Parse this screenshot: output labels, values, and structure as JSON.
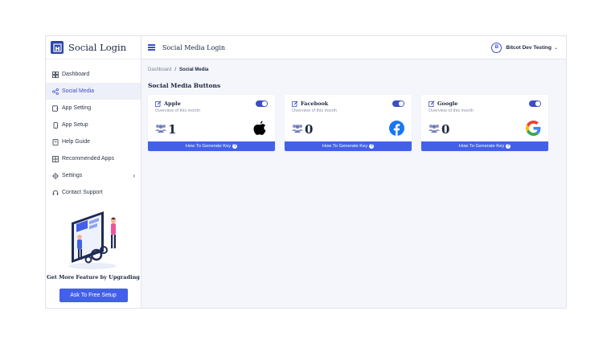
{
  "brand": {
    "title": "Social Login",
    "logo_icon": "house-logo-icon",
    "accent": "#2f46a8"
  },
  "sidebar": {
    "items": [
      {
        "label": "Dashboard",
        "icon": "grid-icon"
      },
      {
        "label": "Social Media",
        "icon": "share-icon",
        "active": true
      },
      {
        "label": "App Setting",
        "icon": "app-setting-icon"
      },
      {
        "label": "App Setup",
        "icon": "phone-icon"
      },
      {
        "label": "Help Guide",
        "icon": "book-icon"
      },
      {
        "label": "Recommended Apps",
        "icon": "apps-grid-icon"
      },
      {
        "label": "Settings",
        "icon": "gear-icon"
      },
      {
        "label": "Contact Support",
        "icon": "headset-icon"
      }
    ],
    "promo": {
      "text": "Get More Feature by Upgrading",
      "button": "Ask To Free Setup"
    }
  },
  "topbar": {
    "title": "Social Media Login",
    "user": {
      "initial": "B",
      "name": "Bitcot Dev Testing"
    }
  },
  "breadcrumb": {
    "home": "Dashboard",
    "sep": "/",
    "current": "Social Media"
  },
  "section_title": "Social Media Buttons",
  "cards": [
    {
      "name": "Apple",
      "subtitle": "Overview of this month",
      "count": "1",
      "enabled": true,
      "button": "How To Generate Key"
    },
    {
      "name": "Facebook",
      "subtitle": "Overview of this month",
      "count": "0",
      "enabled": true,
      "button": "How To Generate Key"
    },
    {
      "name": "Google",
      "subtitle": "Overview of this month",
      "count": "0",
      "enabled": true,
      "button": "How To Generate Key"
    }
  ],
  "colors": {
    "primary": "#4360ea",
    "toggle": "#3d4ec7",
    "background": "#f4f6fb"
  }
}
